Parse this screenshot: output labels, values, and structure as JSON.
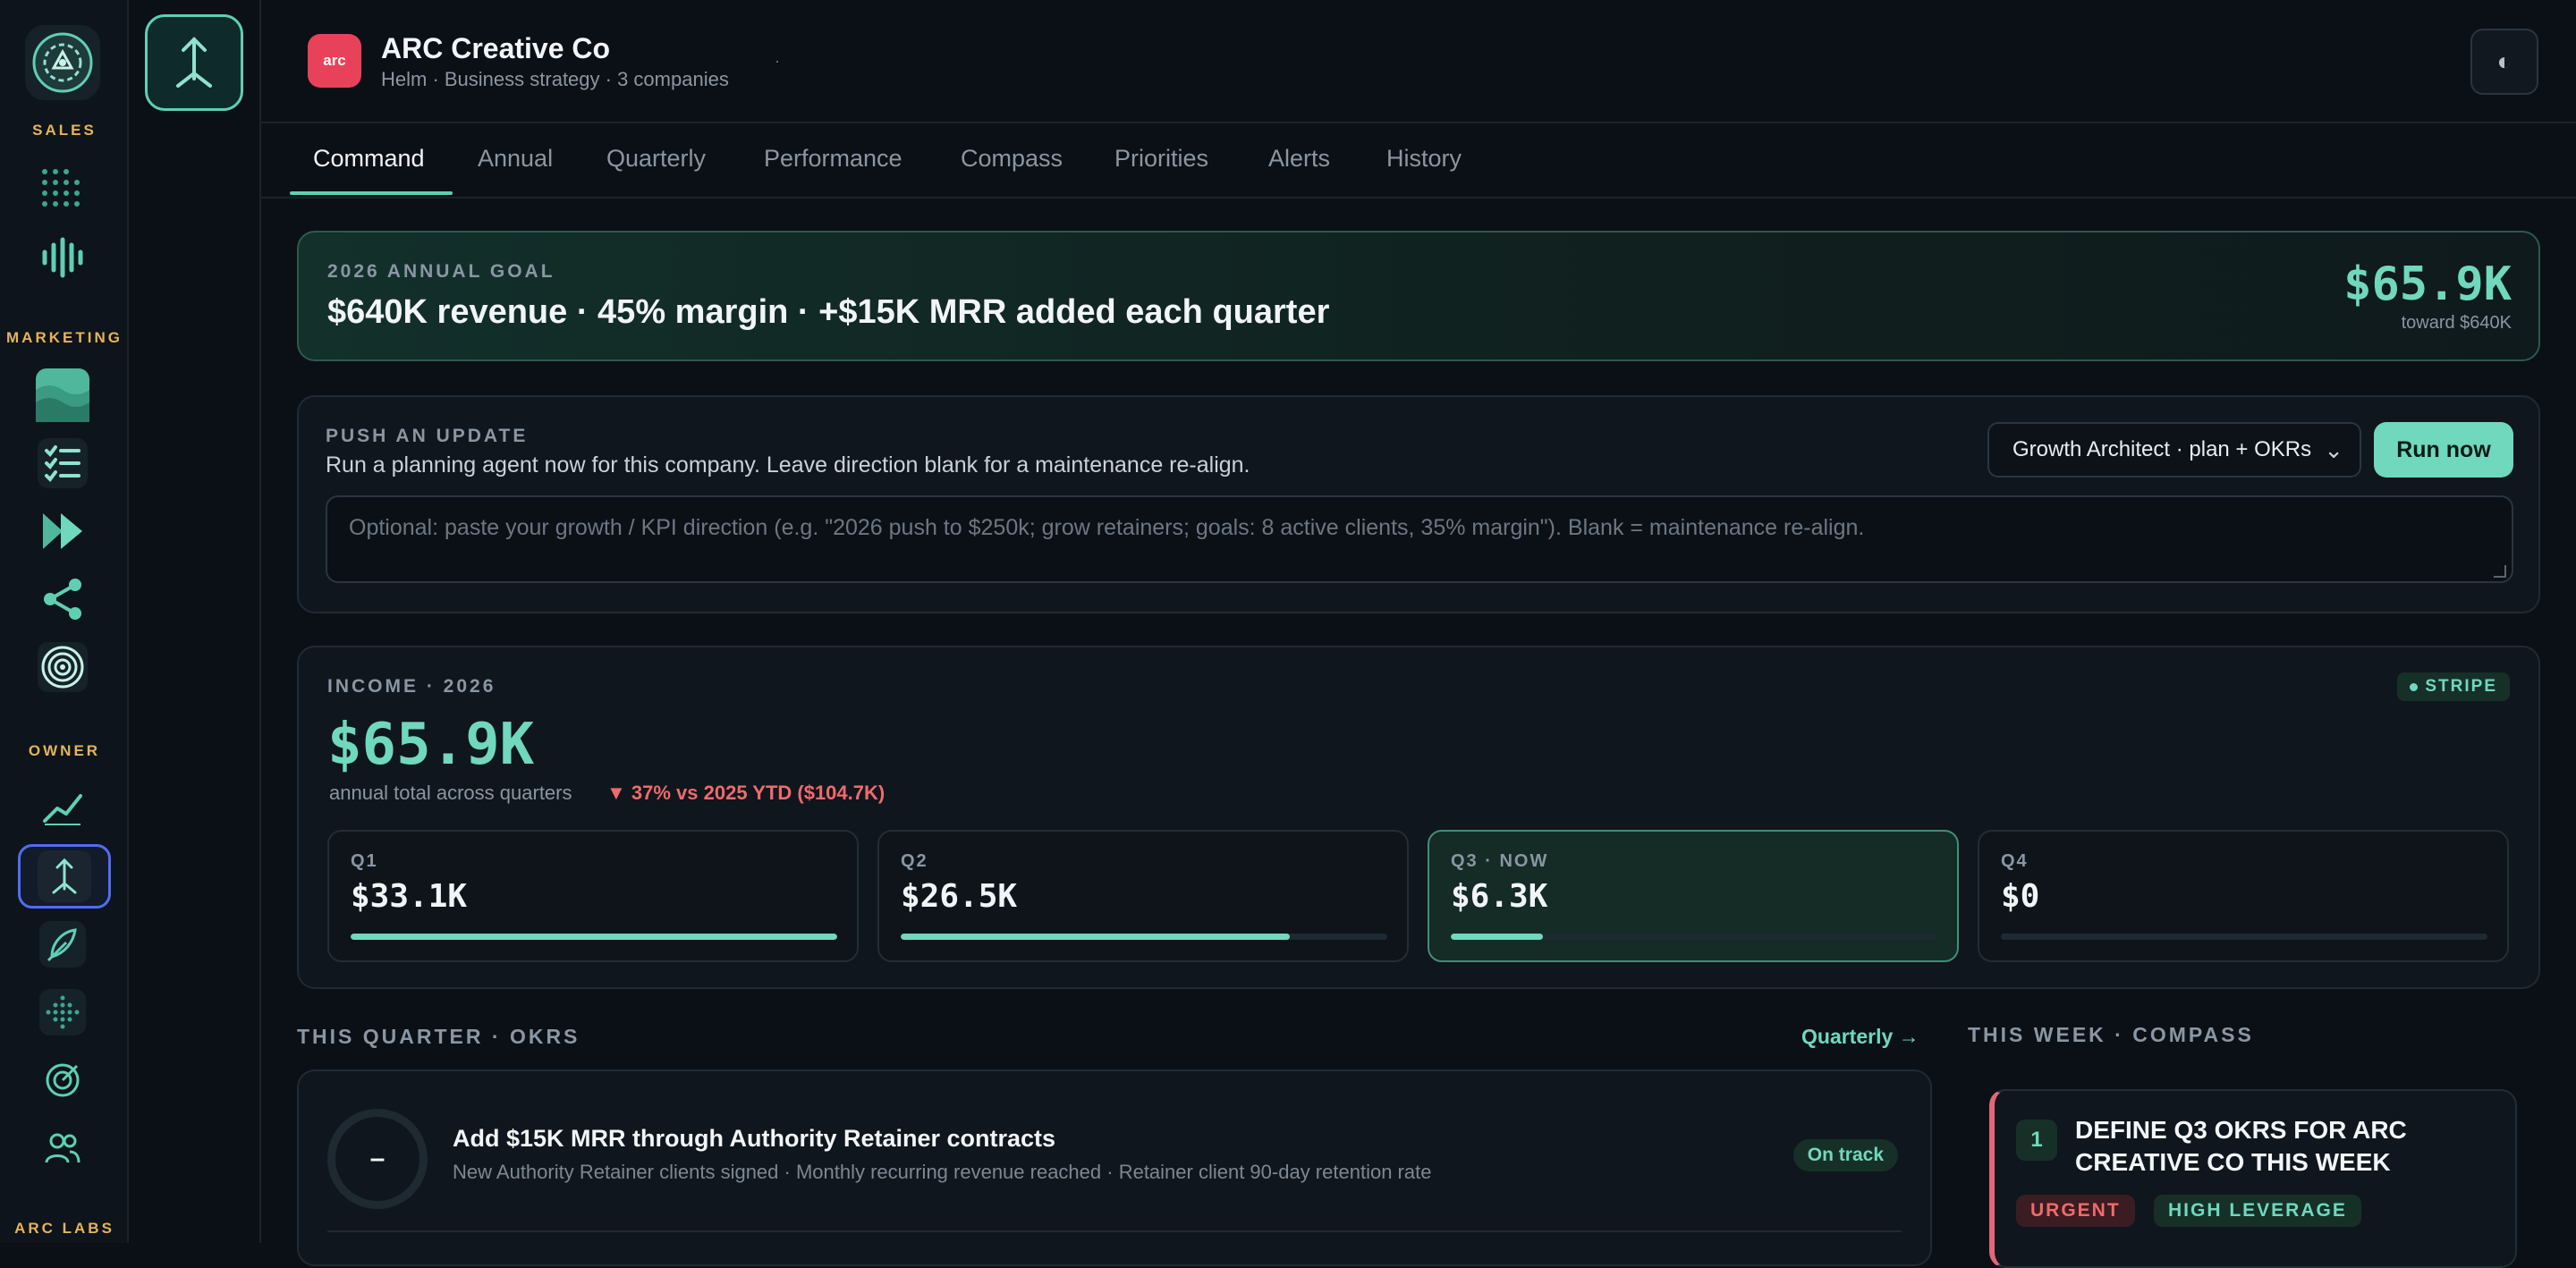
{
  "rail": {
    "sections": [
      "SALES",
      "MARKETING",
      "OWNER",
      "ARC LABS"
    ]
  },
  "company": {
    "logo_text": "arc",
    "name": "ARC Creative Co",
    "subtitle": "Helm · Business strategy · 3 companies",
    "dot": "·"
  },
  "theme_toggle": "◐",
  "tabs": [
    "Command",
    "Annual",
    "Quarterly",
    "Performance",
    "Compass",
    "Priorities",
    "Alerts",
    "History"
  ],
  "goal": {
    "label": "2026 ANNUAL GOAL",
    "text": "$640K revenue · 45% margin · +$15K MRR added each quarter",
    "amount": "$65.9K",
    "toward": "toward $640K"
  },
  "push": {
    "label": "PUSH AN UPDATE",
    "description": "Run a planning agent now for this company. Leave direction blank for a maintenance re-align.",
    "select_value": "Growth Architect · plan + OKRs",
    "run_label": "Run now",
    "placeholder": "Optional: paste your growth / KPI direction (e.g. \"2026 push to $250k; grow retainers; goals: 8 active clients, 35% margin\"). Blank = maintenance re-align."
  },
  "income": {
    "label": "INCOME · 2026",
    "badge": "STRIPE",
    "amount": "$65.9K",
    "subtitle": "annual total across quarters",
    "delta": "▼ 37% vs 2025 YTD ($104.7K)",
    "quarters": [
      {
        "label": "Q1",
        "amount": "$33.1K",
        "progress": 1.0
      },
      {
        "label": "Q2",
        "amount": "$26.5K",
        "progress": 0.8
      },
      {
        "label": "Q3 · NOW",
        "amount": "$6.3K",
        "progress": 0.19
      },
      {
        "label": "Q4",
        "amount": "$0",
        "progress": 0.0
      }
    ]
  },
  "okrs": {
    "title": "THIS QUARTER · OKRS",
    "link": "Quarterly →",
    "items": [
      {
        "ring": "–",
        "title": "Add $15K MRR through Authority Retainer contracts",
        "subtitle": "New Authority Retainer clients signed · Monthly recurring revenue reached · Retainer client 90-day retention rate",
        "status": "On track"
      }
    ]
  },
  "compass": {
    "title": "THIS WEEK · COMPASS",
    "items": [
      {
        "num": "1",
        "title": "DEFINE Q3 OKRS FOR ARC CREATIVE CO THIS WEEK",
        "tags": [
          "URGENT",
          "HIGH LEVERAGE"
        ]
      }
    ]
  },
  "colors": {
    "accent": "#6fd8bd",
    "brand_logo": "#e8425b",
    "negative": "#ef6b6b",
    "section_label": "#e4b45a",
    "active_outline": "#4f6df5"
  },
  "icons": [
    "helm-logo-icon",
    "dot-grid-icon",
    "waveform-icon",
    "waves-app-icon",
    "checklist-icon",
    "fast-forward-icon",
    "share-nodes-icon",
    "target-rings-icon",
    "trend-line-icon",
    "helm-arrow-icon",
    "feather-icon",
    "dotted-cross-icon",
    "crosshair-icon",
    "users-icon",
    "contrast-icon",
    "chevron-down-icon"
  ]
}
